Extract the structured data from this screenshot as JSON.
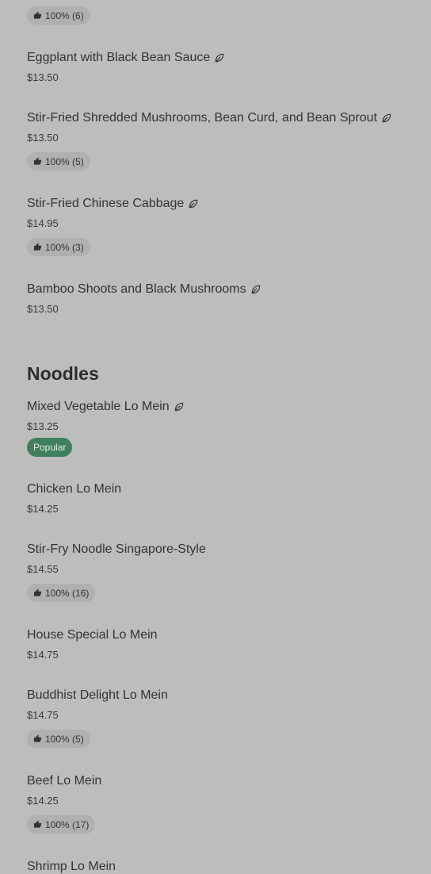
{
  "top_rating": "100% (6)",
  "sections": [
    {
      "title": "",
      "items": [
        {
          "name": "Eggplant with Black Bean Sauce",
          "veg": true,
          "price": "$13.50"
        },
        {
          "name": "Stir-Fried Shredded Mushrooms, Bean Curd, and Bean Sprout",
          "veg": true,
          "price": "$13.50",
          "rating": "100% (5)"
        },
        {
          "name": "Stir-Fried Chinese Cabbage",
          "veg": true,
          "price": "$14.95",
          "rating": "100% (3)"
        },
        {
          "name": "Bamboo Shoots and Black Mushrooms",
          "veg": true,
          "price": "$13.50"
        }
      ]
    },
    {
      "title": "Noodles",
      "items": [
        {
          "name": "Mixed Vegetable Lo Mein",
          "veg": true,
          "price": "$13.25",
          "badge": "Popular"
        },
        {
          "name": "Chicken Lo Mein",
          "price": "$14.25"
        },
        {
          "name": "Stir-Fry Noodle Singapore-Style",
          "price": "$14.55",
          "rating": "100% (16)"
        },
        {
          "name": "House Special Lo Mein",
          "price": "$14.75"
        },
        {
          "name": "Buddhist Delight Lo Mein",
          "price": "$14.75",
          "rating": "100% (5)"
        },
        {
          "name": "Beef Lo Mein",
          "price": "$14.25",
          "rating": "100% (17)"
        },
        {
          "name": "Shrimp Lo Mein"
        }
      ]
    }
  ],
  "colors": {
    "background": "#bdbdbd",
    "rating_pill": "#b0b0b0",
    "popular_badge": "#3f7f5b",
    "text": "#333333"
  },
  "icons": {
    "vegetarian": "leaf-icon",
    "rating": "thumbs-up-icon"
  }
}
